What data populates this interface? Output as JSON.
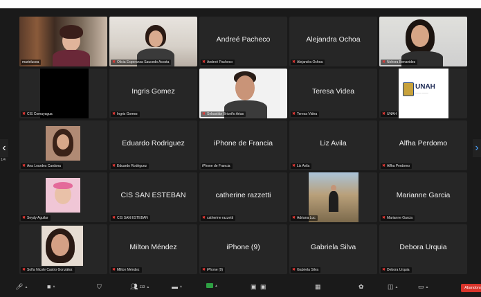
{
  "participants": [
    {
      "label": "marielucea",
      "display": "",
      "kind": "video-shelf",
      "muted": false
    },
    {
      "label": "Olicia Esperanza Saucedo Acosta",
      "display": "",
      "kind": "video-room",
      "muted": true
    },
    {
      "label": "Andreé Pacheco",
      "display": "Andreé Pacheco",
      "kind": "name",
      "muted": true
    },
    {
      "label": "Alejandra Ochoa",
      "display": "Alejandra Ochoa",
      "kind": "name",
      "muted": true
    },
    {
      "label": "Nohora Benavides",
      "display": "",
      "kind": "video-light",
      "muted": true
    },
    {
      "label": "CIS Comayagua",
      "display": "",
      "kind": "black",
      "muted": true
    },
    {
      "label": "Ingris Gomez",
      "display": "Ingris Gomez",
      "kind": "name",
      "muted": true
    },
    {
      "label": "Sebastián Briceño Arias",
      "display": "",
      "kind": "video-man",
      "muted": true
    },
    {
      "label": "Teresa Videa",
      "display": "Teresa Videa",
      "kind": "name",
      "muted": true
    },
    {
      "label": "UNAH",
      "display": "",
      "kind": "unah",
      "muted": true
    },
    {
      "label": "Ana Lourdes Cardona",
      "display": "",
      "kind": "thumb-woman",
      "muted": true
    },
    {
      "label": "Eduardo Rodriguez",
      "display": "Eduardo Rodriguez",
      "kind": "name",
      "muted": true
    },
    {
      "label": "iPhone de Francia",
      "display": "iPhone de Francia",
      "kind": "name",
      "muted": false
    },
    {
      "label": "Liz Avila",
      "display": "Liz Avila",
      "kind": "name",
      "muted": true
    },
    {
      "label": "Alfha Perdomo",
      "display": "Alfha Perdomo",
      "kind": "name",
      "muted": true
    },
    {
      "label": "Seydy Aguilar",
      "display": "",
      "kind": "thumb-baby",
      "muted": true
    },
    {
      "label": "CIS SAN ESTEBAN",
      "display": "CIS SAN ESTEBAN",
      "kind": "name",
      "muted": true
    },
    {
      "label": "catherine razzetti",
      "display": "catherine razzetti",
      "kind": "name",
      "muted": true
    },
    {
      "label": "Adriana Luc",
      "display": "",
      "kind": "thumb-outdoor",
      "muted": true
    },
    {
      "label": "Marianne Garcia",
      "display": "Marianne Garcia",
      "kind": "name",
      "muted": true
    },
    {
      "label": "Sofía Nicole Castro González",
      "display": "",
      "kind": "thumb-selfie",
      "muted": true
    },
    {
      "label": "Milton Méndez",
      "display": "Milton Méndez",
      "kind": "name",
      "muted": true
    },
    {
      "label": "iPhone (9)",
      "display": "iPhone (9)",
      "kind": "name",
      "muted": true
    },
    {
      "label": "Gabriela Silva",
      "display": "Gabriela Silva",
      "kind": "name",
      "muted": true
    },
    {
      "label": "Debora Urquia",
      "display": "Debora Urquia",
      "kind": "name",
      "muted": true
    }
  ],
  "unah_logo_text": "UNAH",
  "left_pager_arrow": "‹",
  "right_pager_arrow": "›",
  "left_pager_page": "1/4",
  "toolbar": {
    "participants_count": "113",
    "end_button": "Abandonar"
  },
  "colors": {
    "stage_bg": "#1a1a1a",
    "tile_bg": "#262626",
    "active_outline": "#3fa34d",
    "muted_icon": "#e53935",
    "end_button": "#d9342b"
  }
}
